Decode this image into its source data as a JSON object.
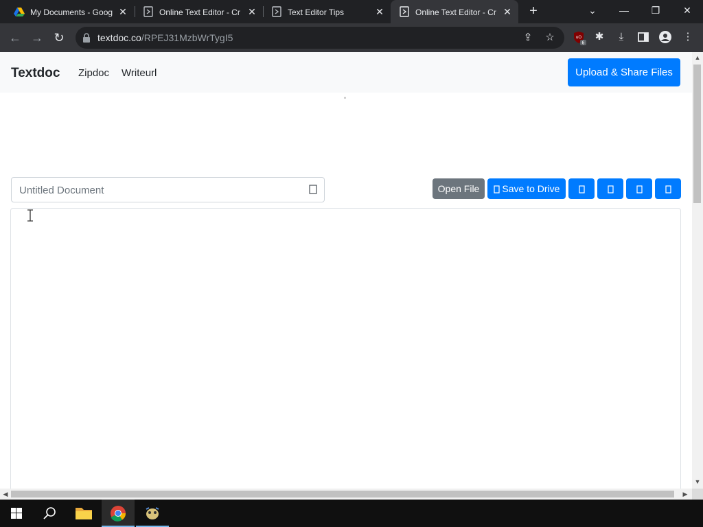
{
  "browser": {
    "tabs": [
      {
        "title": "My Documents - Goog",
        "favicon": "google-drive-icon",
        "active": false
      },
      {
        "title": "Online Text Editor - Cr",
        "favicon": "textdoc-favicon-icon",
        "active": false
      },
      {
        "title": "Text Editor Tips",
        "favicon": "textdoc-favicon-icon",
        "active": false
      },
      {
        "title": "Online Text Editor - Cr",
        "favicon": "textdoc-favicon-icon",
        "active": true
      }
    ],
    "url_host": "textdoc.co",
    "url_path": "/RPEJ31MzbWrTygI5",
    "extension_badge": "6"
  },
  "page": {
    "brand": "Textdoc",
    "nav_links": [
      "Zipdoc",
      "Writeurl"
    ],
    "upload_button": "Upload & Share Files",
    "doc_name_placeholder": "Untitled Document",
    "open_file_button": "Open File",
    "save_drive_button": "Save to Drive"
  },
  "colors": {
    "primary": "#007bff",
    "secondary": "#6c757d",
    "navbar_bg": "#f8f9fa"
  }
}
